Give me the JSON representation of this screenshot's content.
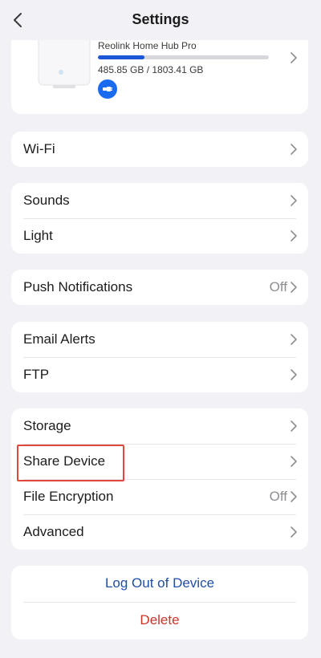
{
  "header": {
    "title": "Settings"
  },
  "device": {
    "name": "Reolink Home Hub Pro",
    "storage_text": "485.85 GB / 1803.41 GB",
    "storage_used_fraction": 0.27
  },
  "groups": {
    "wifi": {
      "label": "Wi-Fi"
    },
    "sounds": {
      "label": "Sounds"
    },
    "light": {
      "label": "Light"
    },
    "push": {
      "label": "Push Notifications",
      "value": "Off"
    },
    "email": {
      "label": "Email Alerts"
    },
    "ftp": {
      "label": "FTP"
    },
    "storage": {
      "label": "Storage"
    },
    "share": {
      "label": "Share Device"
    },
    "encryption": {
      "label": "File Encryption",
      "value": "Off"
    },
    "advanced": {
      "label": "Advanced"
    }
  },
  "actions": {
    "logout": "Log Out of Device",
    "delete": "Delete"
  },
  "colors": {
    "accent_blue": "#1a56d6",
    "logout_blue": "#1f4fa3",
    "delete_red": "#c9352b",
    "highlight_red": "#e2473b"
  }
}
